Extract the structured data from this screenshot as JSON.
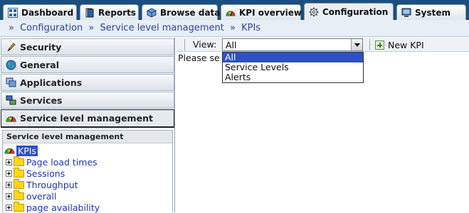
{
  "tabs": [
    {
      "label": "Dashboard",
      "icon": "dashboard-icon"
    },
    {
      "label": "Reports",
      "icon": "reports-icon"
    },
    {
      "label": "Browse data",
      "icon": "cube-icon"
    },
    {
      "label": "KPI overview",
      "icon": "gauge-icon"
    },
    {
      "label": "Configuration",
      "icon": "gear-icon"
    },
    {
      "label": "System",
      "icon": "monitor-icon"
    }
  ],
  "breadcrumb": {
    "sep": "»",
    "items": [
      "Configuration",
      "Service level management",
      "KPIs"
    ]
  },
  "sidebar": {
    "items": [
      {
        "label": "Security",
        "icon": "pen-icon"
      },
      {
        "label": "General",
        "icon": "globe-icon"
      },
      {
        "label": "Applications",
        "icon": "applications-icon"
      },
      {
        "label": "Services",
        "icon": "services-icon"
      },
      {
        "label": "Service level management",
        "icon": "gauge-icon"
      }
    ],
    "tree": {
      "header": "Service level management",
      "root": "KPIs",
      "children": [
        "Page load times",
        "Sessions",
        "Throughput",
        "overall",
        "page availability"
      ]
    }
  },
  "toolbar": {
    "view_label": "View:",
    "view_value": "All",
    "new_kpi_label": "New KPI"
  },
  "main": {
    "placeholder_text": "Please se"
  },
  "dropdown": {
    "options": [
      "All",
      "Service Levels",
      "Alerts"
    ],
    "selected_index": 0
  },
  "colors": {
    "tabbar_bg": "#1a4f7f",
    "link": "#2746a8",
    "selection": "#2d50c8",
    "folder": "#ffd814"
  }
}
